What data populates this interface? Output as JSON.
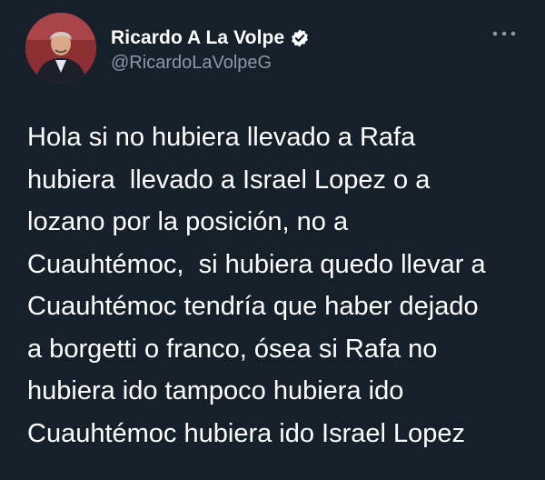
{
  "author": {
    "name": "Ricardo A La Volpe",
    "handle": "@RicardoLaVolpeG",
    "verified": true,
    "avatar_icon": "profile-photo-icon"
  },
  "menu": {
    "icon": "more-options-icon"
  },
  "tweet": {
    "lines": [
      "Hola si no hubiera llevado a Rafa",
      "hubiera  llevado a Israel Lopez o a",
      "lozano por la posición, no a",
      "Cuauhtémoc,  si hubiera quedo llevar a",
      "Cuauhtémoc tendría que haber dejado",
      "a borgetti o franco, ósea si Rafa no",
      "hubiera ido tampoco hubiera ido",
      "Cuauhtémoc hubiera ido Israel Lopez"
    ]
  },
  "colors": {
    "background": "#15202b",
    "text": "#ffffff",
    "secondary_text": "#8b98a5",
    "verified_badge": "#ffffff"
  }
}
